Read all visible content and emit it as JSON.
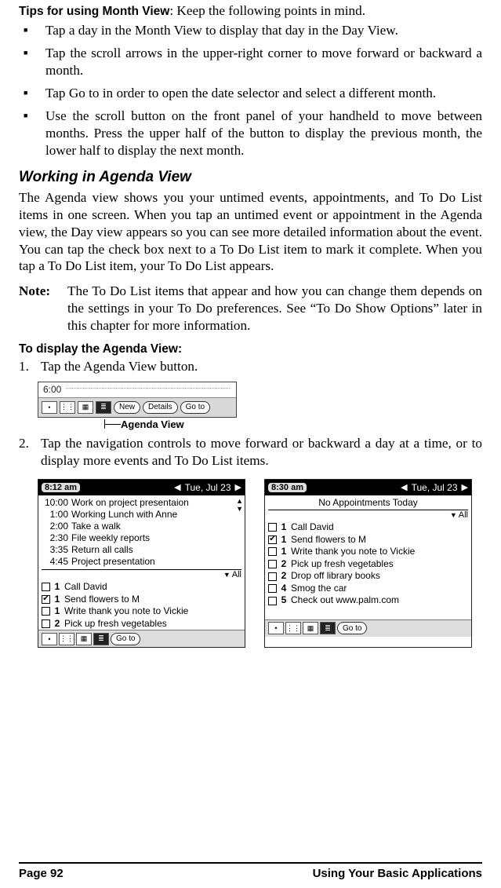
{
  "tips_heading_label": "Tips for using Month View",
  "tips_heading_rest": ": Keep the following points in mind.",
  "tips": [
    "Tap a day in the Month View to display that day in the Day View.",
    "Tap the scroll arrows in the upper-right corner to move forward or backward a month.",
    "Tap Go to in order to open the date selector and select a different month.",
    "Use the scroll button on the front panel of your handheld to move between months. Press the upper half of the button to display the previous month, the lower half to display the next month."
  ],
  "agenda_heading": "Working in Agenda View",
  "agenda_para": "The Agenda view shows you your untimed events, appointments, and To Do List items in one screen. When you tap an untimed event or appointment in the Agenda view, the Day view appears so you can see more detailed information about the event. You can tap the check box next to a To Do List item to mark it complete. When you tap a To Do List item, your To Do List appears.",
  "note_label": "Note:",
  "note_text": "The To Do List items that appear and how you can change them depends on the settings in your To Do preferences. See “To Do Show Options” later in this chapter for more information.",
  "display_heading": "To display the Agenda View:",
  "steps": [
    "Tap the Agenda View button.",
    "Tap the navigation controls to move forward or backward a day at a time, or to display more events and To Do List items."
  ],
  "fig1": {
    "time": "6:00",
    "new_label": "New",
    "details_label": "Details",
    "goto_label": "Go to",
    "callout": "Agenda View"
  },
  "screen_left": {
    "clock": "8:12 am",
    "date": "Tue, Jul 23",
    "appts": [
      {
        "time": "10:00",
        "text": "Work on project presentaion"
      },
      {
        "time": "1:00",
        "text": "Working Lunch with Anne"
      },
      {
        "time": "2:00",
        "text": "Take a walk"
      },
      {
        "time": "2:30",
        "text": "File weekly reports"
      },
      {
        "time": "3:35",
        "text": "Return all calls"
      },
      {
        "time": "4:45",
        "text": "Project presentation"
      }
    ],
    "filter": "All",
    "todos": [
      {
        "done": false,
        "pri": "1",
        "text": "Call David"
      },
      {
        "done": true,
        "pri": "1",
        "text": "Send flowers to M"
      },
      {
        "done": false,
        "pri": "1",
        "text": "Write thank you note to Vickie"
      },
      {
        "done": false,
        "pri": "2",
        "text": "Pick up fresh vegetables"
      }
    ],
    "goto_label": "Go to"
  },
  "screen_right": {
    "clock": "8:30 am",
    "date": "Tue, Jul 23",
    "no_appt": "No Appointments Today",
    "filter": "All",
    "todos": [
      {
        "done": false,
        "pri": "1",
        "text": "Call David"
      },
      {
        "done": true,
        "pri": "1",
        "text": "Send flowers to M"
      },
      {
        "done": false,
        "pri": "1",
        "text": "Write thank you note to Vickie"
      },
      {
        "done": false,
        "pri": "2",
        "text": "Pick up fresh vegetables"
      },
      {
        "done": false,
        "pri": "2",
        "text": "Drop off library books"
      },
      {
        "done": false,
        "pri": "4",
        "text": "Smog the car"
      },
      {
        "done": false,
        "pri": "5",
        "text": "Check out www.palm.com"
      }
    ],
    "goto_label": "Go to"
  },
  "footer": {
    "page_label": "Page 92",
    "section_label": "Using Your Basic Applications"
  }
}
